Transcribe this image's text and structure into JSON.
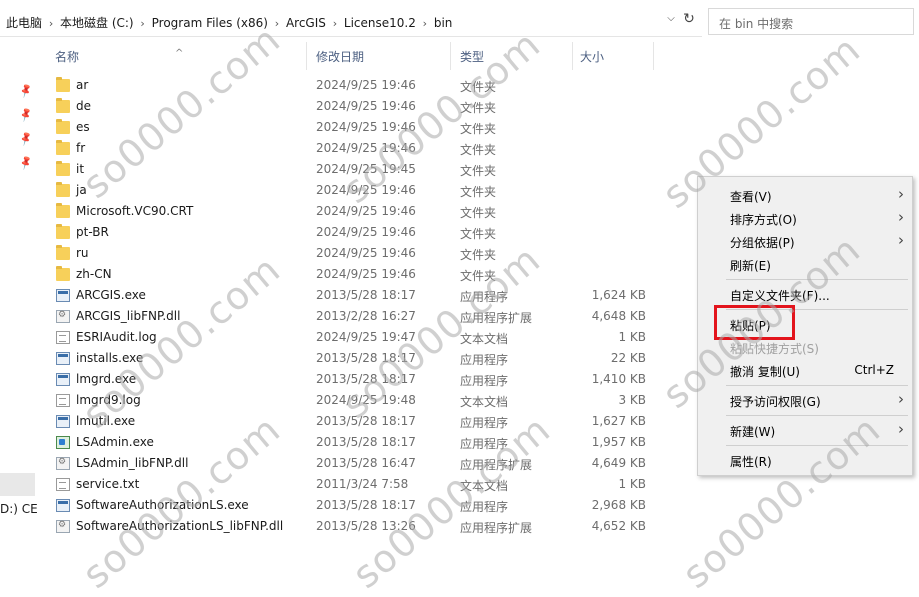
{
  "address": {
    "crumbs": [
      "此电脑",
      "本地磁盘 (C:)",
      "Program Files (x86)",
      "ArcGIS",
      "License10.2",
      "bin"
    ],
    "dropdown_icon": "chevron-down-icon",
    "refresh_icon": "refresh-icon"
  },
  "search": {
    "placeholder": "在 bin 中搜索"
  },
  "nav": {
    "drive_label": "D:) CE"
  },
  "columns": {
    "name": "名称",
    "date": "修改日期",
    "type": "类型",
    "size": "大小"
  },
  "files": [
    {
      "name": "ar",
      "date": "2024/9/25 19:46",
      "type": "文件夹",
      "size": "",
      "kind": "folder"
    },
    {
      "name": "de",
      "date": "2024/9/25 19:46",
      "type": "文件夹",
      "size": "",
      "kind": "folder"
    },
    {
      "name": "es",
      "date": "2024/9/25 19:46",
      "type": "文件夹",
      "size": "",
      "kind": "folder"
    },
    {
      "name": "fr",
      "date": "2024/9/25 19:46",
      "type": "文件夹",
      "size": "",
      "kind": "folder"
    },
    {
      "name": "it",
      "date": "2024/9/25 19:45",
      "type": "文件夹",
      "size": "",
      "kind": "folder"
    },
    {
      "name": "ja",
      "date": "2024/9/25 19:46",
      "type": "文件夹",
      "size": "",
      "kind": "folder"
    },
    {
      "name": "Microsoft.VC90.CRT",
      "date": "2024/9/25 19:46",
      "type": "文件夹",
      "size": "",
      "kind": "folder"
    },
    {
      "name": "pt-BR",
      "date": "2024/9/25 19:46",
      "type": "文件夹",
      "size": "",
      "kind": "folder"
    },
    {
      "name": "ru",
      "date": "2024/9/25 19:46",
      "type": "文件夹",
      "size": "",
      "kind": "folder"
    },
    {
      "name": "zh-CN",
      "date": "2024/9/25 19:46",
      "type": "文件夹",
      "size": "",
      "kind": "folder"
    },
    {
      "name": "ARCGIS.exe",
      "date": "2013/5/28 18:17",
      "type": "应用程序",
      "size": "1,624 KB",
      "kind": "exe"
    },
    {
      "name": "ARCGIS_libFNP.dll",
      "date": "2013/2/28 16:27",
      "type": "应用程序扩展",
      "size": "4,648 KB",
      "kind": "dll"
    },
    {
      "name": "ESRIAudit.log",
      "date": "2024/9/25 19:47",
      "type": "文本文档",
      "size": "1 KB",
      "kind": "txt"
    },
    {
      "name": "installs.exe",
      "date": "2013/5/28 18:17",
      "type": "应用程序",
      "size": "22 KB",
      "kind": "exe"
    },
    {
      "name": "lmgrd.exe",
      "date": "2013/5/28 18:17",
      "type": "应用程序",
      "size": "1,410 KB",
      "kind": "exe"
    },
    {
      "name": "lmgrd9.log",
      "date": "2024/9/25 19:48",
      "type": "文本文档",
      "size": "3 KB",
      "kind": "txt"
    },
    {
      "name": "lmutil.exe",
      "date": "2013/5/28 18:17",
      "type": "应用程序",
      "size": "1,627 KB",
      "kind": "exe"
    },
    {
      "name": "LSAdmin.exe",
      "date": "2013/5/28 18:17",
      "type": "应用程序",
      "size": "1,957 KB",
      "kind": "app"
    },
    {
      "name": "LSAdmin_libFNP.dll",
      "date": "2013/5/28 16:47",
      "type": "应用程序扩展",
      "size": "4,649 KB",
      "kind": "dll"
    },
    {
      "name": "service.txt",
      "date": "2011/3/24 7:58",
      "type": "文本文档",
      "size": "1 KB",
      "kind": "txt"
    },
    {
      "name": "SoftwareAuthorizationLS.exe",
      "date": "2013/5/28 18:17",
      "type": "应用程序",
      "size": "2,968 KB",
      "kind": "exe"
    },
    {
      "name": "SoftwareAuthorizationLS_libFNP.dll",
      "date": "2013/5/28 13:26",
      "type": "应用程序扩展",
      "size": "4,652 KB",
      "kind": "dll"
    }
  ],
  "context_menu": {
    "items": [
      {
        "label": "查看(V)",
        "submenu": true
      },
      {
        "label": "排序方式(O)",
        "submenu": true
      },
      {
        "label": "分组依据(P)",
        "submenu": true
      },
      {
        "label": "刷新(E)"
      },
      {
        "label": "自定义文件夹(F)..."
      },
      {
        "label": "粘贴(P)"
      },
      {
        "label": "粘贴快捷方式(S)",
        "disabled": true
      },
      {
        "label": "撤消 复制(U)",
        "shortcut": "Ctrl+Z"
      },
      {
        "label": "授予访问权限(G)",
        "submenu": true
      },
      {
        "label": "新建(W)",
        "submenu": true
      },
      {
        "label": "属性(R)"
      }
    ]
  },
  "watermark": "so0000.com"
}
